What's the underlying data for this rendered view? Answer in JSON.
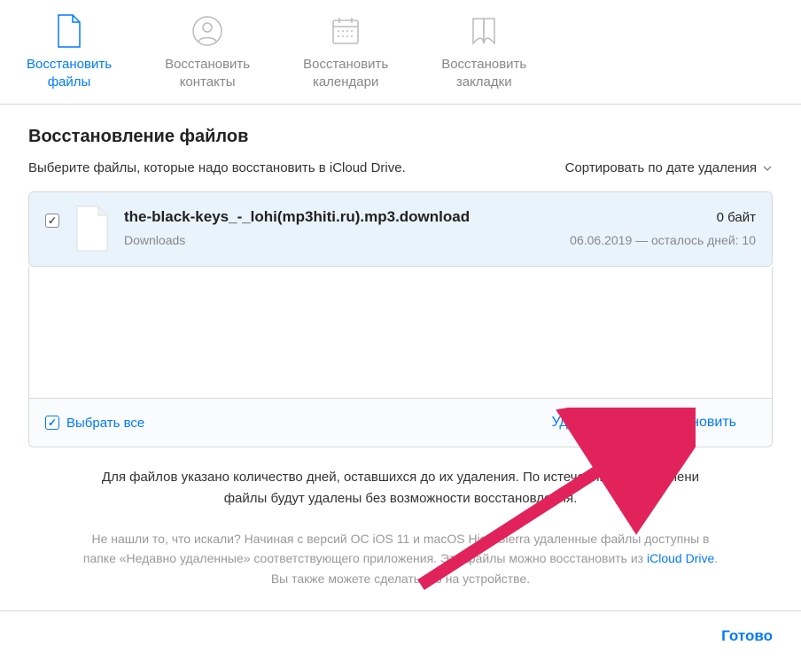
{
  "tabs": [
    {
      "label": "Восстановить\nфайлы",
      "active": true
    },
    {
      "label": "Восстановить\nконтакты",
      "active": false
    },
    {
      "label": "Восстановить\nкалендари",
      "active": false
    },
    {
      "label": "Восстановить\nзакладки",
      "active": false
    }
  ],
  "section": {
    "title": "Восстановление файлов",
    "instruction": "Выберите файлы, которые надо восстановить в iCloud Drive.",
    "sort_label": "Сортировать по дате удаления"
  },
  "files": [
    {
      "name": "the-black-keys_-_lohi(mp3hiti.ru).mp3.download",
      "size": "0 байт",
      "location": "Downloads",
      "expiry": "06.06.2019 — осталось дней: 10",
      "checked": true
    }
  ],
  "toolbar": {
    "select_all": "Выбрать все",
    "delete": "Удалить",
    "restore": "Восстановить"
  },
  "footer": {
    "main": "Для файлов указано количество дней, оставшихся до их удаления. По истечении этого времени файлы будут удалены без возможности восстановления.",
    "sub_pre": "Не нашли то, что искали? Начиная с версий ОС iOS 11 и macOS High Sierra удаленные файлы доступны в папке «Недавно удаленные» соответствующего приложения. Эти файлы можно восстановить из ",
    "sub_link": "iCloud Drive",
    "sub_post": ". Вы также можете сделать это на устройстве."
  },
  "done": "Готово"
}
